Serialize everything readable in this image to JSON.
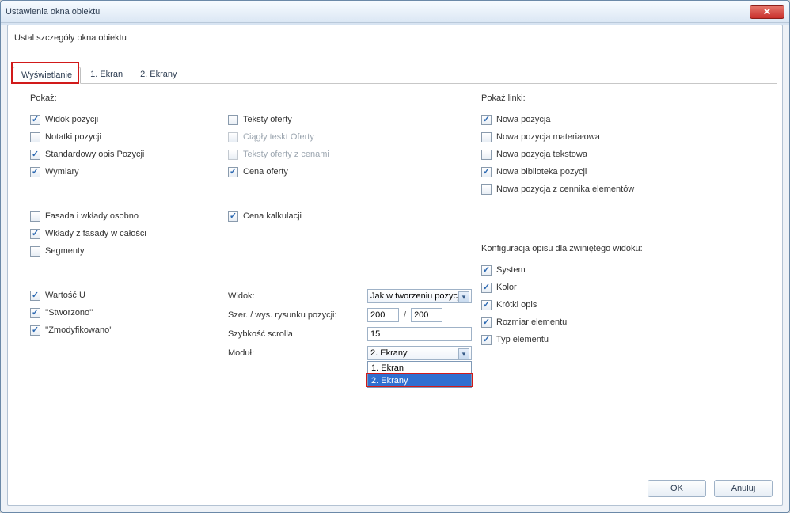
{
  "window": {
    "title": "Ustawienia okna obiektu"
  },
  "subtitle": "Ustal szczegóły okna obiektu",
  "tabs": [
    {
      "label": "Wyświetlanie",
      "active": true
    },
    {
      "label": "1. Ekran",
      "active": false
    },
    {
      "label": "2. Ekrany",
      "active": false
    }
  ],
  "sections": {
    "show": "Pokaż:",
    "show_links": "Pokaż linki:",
    "collapsed_desc": "Konfiguracja opisu dla zwiniętego widoku:"
  },
  "checks": {
    "widok_pozycji": {
      "label": "Widok pozycji",
      "checked": true
    },
    "notatki_pozycji": {
      "label": "Notatki pozycji",
      "checked": false
    },
    "std_opis_pozycji": {
      "label": "Standardowy opis Pozycji",
      "checked": true
    },
    "wymiary": {
      "label": "Wymiary",
      "checked": true
    },
    "teksty_oferty": {
      "label": "Teksty oferty",
      "checked": false
    },
    "ciagly_tekst_oferty": {
      "label": "Ciągły teskt Oferty",
      "checked": false,
      "disabled": true
    },
    "teksty_oferty_cena": {
      "label": "Teksty oferty z cenami",
      "checked": false,
      "disabled": true
    },
    "cena_oferty": {
      "label": "Cena oferty",
      "checked": true
    },
    "fasada_osobno": {
      "label": "Fasada i wkłady osobno",
      "checked": false
    },
    "wklady_calosc": {
      "label": "Wkłady z fasady w całości",
      "checked": true
    },
    "segmenty": {
      "label": "Segmenty",
      "checked": false
    },
    "cena_kalkulacji": {
      "label": "Cena kalkulacji",
      "checked": true
    },
    "wartosc_u": {
      "label": "Wartość U",
      "checked": true
    },
    "stworzono": {
      "label": "''Stworzono''",
      "checked": true
    },
    "zmodyfikowano": {
      "label": "''Zmodyfikowano''",
      "checked": true
    },
    "nowa_pozycja": {
      "label": "Nowa pozycja",
      "checked": true
    },
    "nowa_materialowa": {
      "label": "Nowa pozycja materiałowa",
      "checked": false
    },
    "nowa_tekstowa": {
      "label": "Nowa pozycja tekstowa",
      "checked": false
    },
    "nowa_biblioteka": {
      "label": "Nowa biblioteka pozycji",
      "checked": true
    },
    "nowa_cennik": {
      "label": "Nowa pozycja z cennika elementów",
      "checked": false
    },
    "cd_system": {
      "label": "System",
      "checked": true
    },
    "cd_kolor": {
      "label": "Kolor",
      "checked": true
    },
    "cd_krotki_opis": {
      "label": "Krótki opis",
      "checked": true
    },
    "cd_rozmiar": {
      "label": "Rozmiar elementu",
      "checked": true
    },
    "cd_typ": {
      "label": "Typ elementu",
      "checked": true
    }
  },
  "fields": {
    "widok": {
      "label": "Widok:",
      "value": "Jak w tworzeniu pozycji"
    },
    "szer": {
      "label": "Szer. / wys. rysunku pozycji:",
      "w": "200",
      "h": "200"
    },
    "scroll": {
      "label": "Szybkość scrolla",
      "value": "15"
    },
    "modul": {
      "label": "Moduł:",
      "value": "2. Ekrany",
      "options": [
        "1. Ekran",
        "2. Ekrany"
      ],
      "selected_index": 1
    }
  },
  "buttons": {
    "ok_u": "O",
    "ok_rest": "K",
    "cancel_u": "A",
    "cancel_rest": "nuluj"
  }
}
